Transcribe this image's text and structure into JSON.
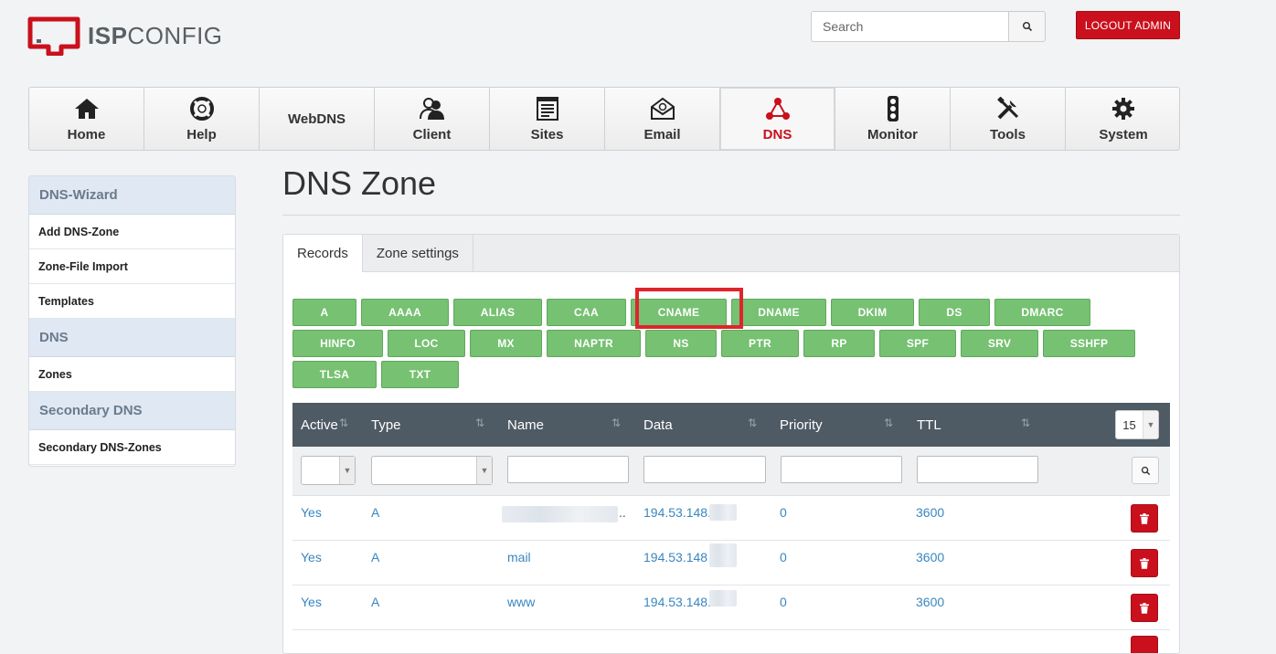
{
  "brand": {
    "bold": "ISP",
    "rest": "CONFIG"
  },
  "search": {
    "placeholder": "Search"
  },
  "logout": {
    "label": "LOGOUT ADMIN"
  },
  "nav": [
    {
      "label": "Home",
      "icon": "home-icon"
    },
    {
      "label": "Help",
      "icon": "lifebuoy-icon"
    },
    {
      "label": "WebDNS",
      "icon": ""
    },
    {
      "label": "Client",
      "icon": "users-icon"
    },
    {
      "label": "Sites",
      "icon": "sites-icon"
    },
    {
      "label": "Email",
      "icon": "email-icon"
    },
    {
      "label": "DNS",
      "icon": "dns-icon",
      "active": true
    },
    {
      "label": "Monitor",
      "icon": "traffic-light-icon"
    },
    {
      "label": "Tools",
      "icon": "tools-icon"
    },
    {
      "label": "System",
      "icon": "gear-icon"
    }
  ],
  "sidebar": {
    "sections": [
      {
        "title": "DNS-Wizard",
        "items": [
          "Add DNS-Zone",
          "Zone-File Import",
          "Templates"
        ]
      },
      {
        "title": "DNS",
        "items": [
          "Zones"
        ]
      },
      {
        "title": "Secondary DNS",
        "items": [
          "Secondary DNS-Zones"
        ]
      }
    ]
  },
  "page": {
    "title": "DNS Zone"
  },
  "tabs": [
    {
      "label": "Records",
      "active": true
    },
    {
      "label": "Zone settings"
    }
  ],
  "record_types": [
    "A",
    "AAAA",
    "ALIAS",
    "CAA",
    "CNAME",
    "DNAME",
    "DKIM",
    "DS",
    "DMARC",
    "HINFO",
    "LOC",
    "MX",
    "NAPTR",
    "NS",
    "PTR",
    "RP",
    "SPF",
    "SRV",
    "SSHFP",
    "TLSA",
    "TXT"
  ],
  "highlighted_type": "CNAME",
  "table": {
    "columns": [
      "Active",
      "Type",
      "Name",
      "Data",
      "Priority",
      "TTL"
    ],
    "page_size": "15",
    "rows": [
      {
        "active": "Yes",
        "type": "A",
        "name": "..",
        "data": "194.53.148.",
        "priority": "0",
        "ttl": "3600"
      },
      {
        "active": "Yes",
        "type": "A",
        "name": "mail",
        "data": "194.53.148",
        "priority": "0",
        "ttl": "3600"
      },
      {
        "active": "Yes",
        "type": "A",
        "name": "www",
        "data": "194.53.148.",
        "priority": "0",
        "ttl": "3600"
      }
    ]
  },
  "colors": {
    "accent": "#c9101c",
    "record_button": "#76c172",
    "table_header": "#4e5a64",
    "link": "#3a86c0"
  }
}
